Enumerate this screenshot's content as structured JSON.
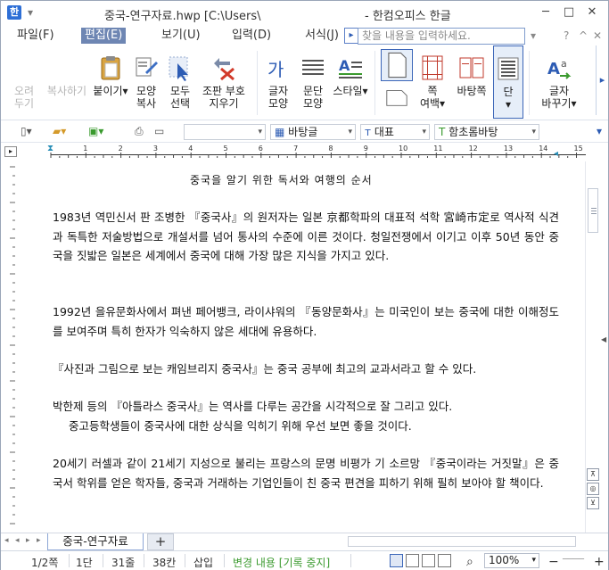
{
  "titlebar": {
    "app_icon": "한",
    "title": "중국-연구자료.hwp [C:\\Users\\",
    "app_name": "- 한컴오피스 한글",
    "minimize": "─",
    "maximize": "□",
    "close": "✕"
  },
  "menubar": {
    "items": [
      "파일(F)",
      "편집(E)",
      "보기(U)",
      "입력(D)",
      "서식(J)"
    ],
    "active_index": 1,
    "more": "▸",
    "search_placeholder": "찾을 내용을 입력하세요.",
    "search_arrow": "▾",
    "help": "?",
    "collapse": "^",
    "close_doc": "✕"
  },
  "ribbon": {
    "buttons": [
      {
        "id": "cut",
        "label1": "오려",
        "label2": "두기",
        "disabled": true
      },
      {
        "id": "copy",
        "label1": "복사하기",
        "label2": "",
        "disabled": true
      },
      {
        "id": "paste",
        "label1": "붙이기",
        "label2": "",
        "dropdown": true
      },
      {
        "id": "format-copy",
        "label1": "모양",
        "label2": "복사"
      },
      {
        "id": "select-all",
        "label1": "모두",
        "label2": "선택"
      },
      {
        "id": "delete-code",
        "label1": "조판 부호",
        "label2": "지우기"
      },
      {
        "id": "char-shape",
        "label1": "글자",
        "label2": "모양"
      },
      {
        "id": "para-shape",
        "label1": "문단",
        "label2": "모양"
      },
      {
        "id": "style",
        "label1": "스타일",
        "label2": "",
        "dropdown": true
      },
      {
        "id": "page-margin",
        "label1": "쪽",
        "label2": "여백",
        "dropdown": true
      },
      {
        "id": "facing-pages",
        "label1": "바탕쪽",
        "label2": ""
      },
      {
        "id": "columns",
        "label1": "단",
        "label2": "",
        "dropdown": true
      },
      {
        "id": "replace-char",
        "label1": "글자",
        "label2": "바꾸기",
        "dropdown": true
      }
    ],
    "char_icon_text": "가",
    "scroll_arrow": "▸",
    "scroll_down": "▾"
  },
  "toolbar2": {
    "combos": [
      {
        "id": "undo-combo",
        "value": "",
        "disabled": true
      },
      {
        "id": "style-combo",
        "value": "바탕글"
      },
      {
        "id": "lang-combo",
        "value": "대표"
      },
      {
        "id": "font-combo",
        "value": "함초롬바탕"
      }
    ],
    "arrow": "▾"
  },
  "ruler": {
    "labels": [
      "1",
      "2",
      "3",
      "4",
      "5",
      "6",
      "7",
      "8",
      "9",
      "10",
      "11",
      "12",
      "13",
      "14",
      "15"
    ],
    "corner": "▸"
  },
  "document": {
    "title": "중국을 알기 위한 독서와 여행의 순서",
    "paragraphs": [
      {
        "lines": [
          "1983년 역민신서 판 조병한 『중국사』의 원저자는 일본 京都학파의 대표적 석학 宮崎市定로 역사적 식견과  독특한 저술방법으로 개설서를 넘어 통사의 수준에 이른 것이다. 청일전쟁에서 이기고 이후 50년 동안 중국을 짓밟은 일본은 세계에서 중국에 대해 가장 많은 지식을 가지고 있다."
        ],
        "indent": null
      },
      {
        "lines": [
          "1992년 을유문화사에서 펴낸 페어뱅크, 라이샤워의 『동양문화사』는 미국인이 보는 중국에 대한 이해정도를 보여주며 특히 한자가 익숙하지 않은 세대에 유용하다."
        ],
        "indent": null
      },
      {
        "lines": [
          "『사진과 그림으로 보는 캐임브리지 중국사』는 중국 공부에 최고의 교과서라고 할 수 있다."
        ],
        "indent": null
      },
      {
        "lines": [
          "박한제 등의 『아틀라스 중국사』는 역사를 다루는 공간을 시각적으로 잘 그리고 있다."
        ],
        "indent": "중고등학생들이 중국사에 대한 상식을 익히기 위해 우선 보면 좋을 것이다."
      },
      {
        "lines": [
          "20세기 러셀과 같이 21세기 지성으로 불리는 프랑스의 문명 비평가 기 소르망 『중국이라는 거짓말』은 중국서 학위를 얻은 학자들, 중국과 거래하는 기업인들이 친 중국 편견을 피하기 위해 필히 보아야 할 책이다."
        ],
        "indent": null
      }
    ]
  },
  "tabbar": {
    "doc_tab": "중국-연구자료",
    "add_tab": "+",
    "nav": [
      "◂",
      "◂",
      "▸",
      "▸"
    ]
  },
  "statusbar": {
    "page": "1/2쪽",
    "column": "1단",
    "line": "31줄",
    "col": "38칸",
    "insert": "삽입",
    "track_changes": "변경 내용 [기록 중지]",
    "zoom": "100%",
    "zoom_out": "−",
    "zoom_in": "+"
  },
  "colors": {
    "accent": "#2d5cb4",
    "menu_active_bg": "#6e86b3",
    "status_green": "#3a9a2e"
  }
}
